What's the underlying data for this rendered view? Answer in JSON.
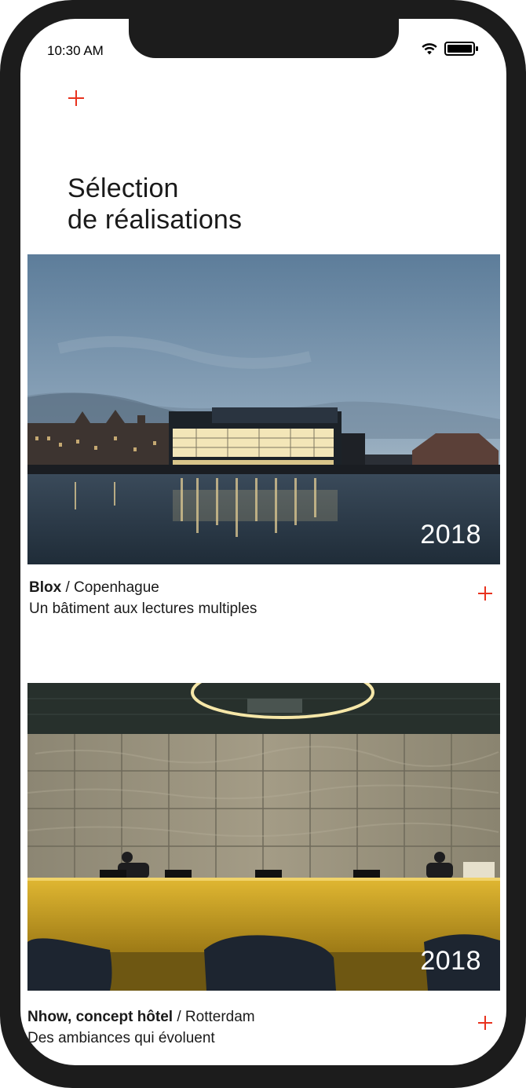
{
  "status_bar": {
    "time": "10:30 AM",
    "icons": [
      "wifi-icon",
      "battery-icon"
    ]
  },
  "header": {
    "menu_icon": "plus-icon",
    "accent_color": "#e8321e"
  },
  "page": {
    "title_line1": "Sélection",
    "title_line2": "de réalisations"
  },
  "projects": [
    {
      "name": "Blox",
      "separator": " / ",
      "city": "Copenhague",
      "description": "Un bâtiment aux lectures multiples",
      "year": "2018",
      "image": "night-waterfront-building"
    },
    {
      "name": "Nhow, concept hôtel",
      "separator": " / ",
      "city": "Rotterdam",
      "description": "Des ambiances qui évoluent",
      "year": "2018",
      "image": "hotel-reception-desk"
    }
  ]
}
